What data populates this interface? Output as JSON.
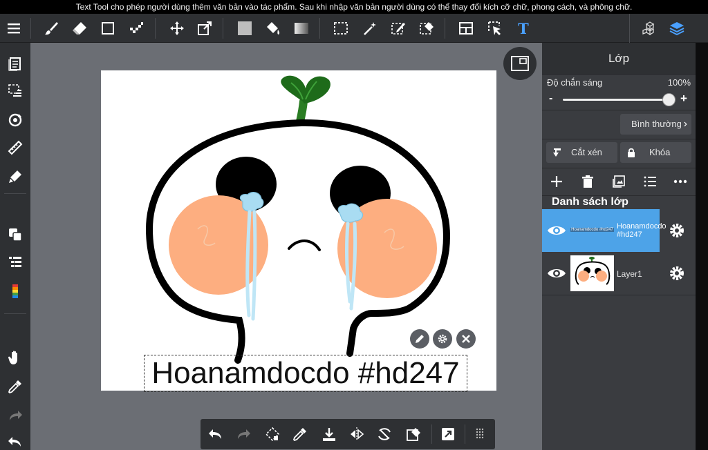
{
  "caption": "Text Tool cho phép người dùng thêm văn bản vào tác phẩm. Sau khi nhập văn bản người dùng có thể thay đổi kích cỡ chữ, phong cách, và phông chữ.",
  "toolbar": {
    "text_tool_glyph": "T",
    "active_color": "#4aa0ff",
    "tools": [
      "menu-icon",
      "brush-icon",
      "eraser-icon",
      "shape-icon",
      "dot-icon",
      "move-icon",
      "transform-icon",
      "fill-color-icon",
      "bucket-icon",
      "gradient-icon",
      "select-rect-icon",
      "magic-wand-icon",
      "select-pen-icon",
      "select-eraser-icon",
      "frame-icon",
      "select-move-icon",
      "text-tool-icon",
      "material-icon",
      "layers-icon"
    ]
  },
  "leftbar": {
    "tools": [
      "pages-icon",
      "select-layer-icon",
      "rotate-view-icon",
      "ruler-icon",
      "fill-pen-icon",
      "copy-layers-icon",
      "layer-list-icon",
      "color-palette-icon",
      "hand-icon",
      "eyedropper-icon",
      "redo-icon",
      "undo-icon"
    ]
  },
  "canvas": {
    "text_content": "Hoanamdocdo #hd247"
  },
  "bottombar": {
    "tools": [
      "undo-icon",
      "redo-icon",
      "transform-icon",
      "eyedropper-icon",
      "save-icon",
      "flip-icon",
      "rotate-icon",
      "clear-icon",
      "export-icon",
      "grid-icon"
    ]
  },
  "panel": {
    "title": "Lớp",
    "opacity_label": "Độ chắn sáng",
    "opacity_value": "100%",
    "opacity_fraction": 1.0,
    "minus": "-",
    "plus": "+",
    "blend_mode": "Bình thường",
    "clip_label": "Cắt xén",
    "lock_label": "Khóa",
    "list_title": "Danh sách lớp",
    "layers": [
      {
        "name": "Hoanamdocdo #hd247",
        "thumb_text": "Hoanamdocdo #hd247",
        "active": true
      },
      {
        "name": "Layer1",
        "active": false
      }
    ],
    "highlight_color": "#4da3e8"
  }
}
